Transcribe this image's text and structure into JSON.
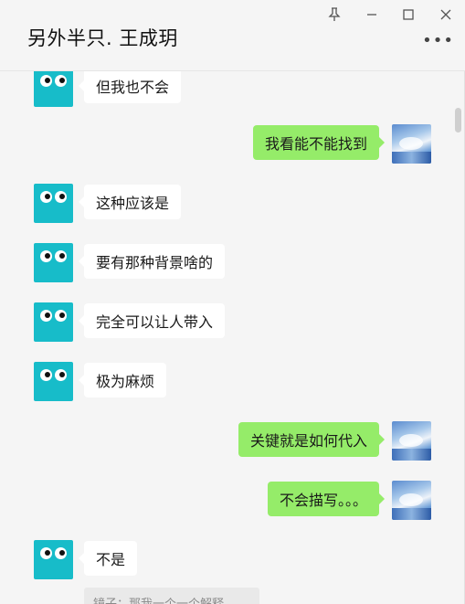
{
  "window": {
    "title": "另外半只. 王成玥",
    "more_label": "•••"
  },
  "messages": [
    {
      "side": "left",
      "text": "但我也不会"
    },
    {
      "side": "right",
      "text": "我看能不能找到"
    },
    {
      "side": "left",
      "text": "这种应该是"
    },
    {
      "side": "left",
      "text": "要有那种背景啥的"
    },
    {
      "side": "left",
      "text": "完全可以让人带入"
    },
    {
      "side": "left",
      "text": "极为麻烦"
    },
    {
      "side": "right",
      "text": "关键就是如何代入"
    },
    {
      "side": "right",
      "text": "不会描写。。。"
    },
    {
      "side": "left",
      "text": "不是"
    }
  ],
  "quote": {
    "text": "镜子：那我一个一个解释"
  },
  "icons": {
    "pin": "pin-icon",
    "minimize": "minimize-icon",
    "maximize": "maximize-icon",
    "close": "close-icon",
    "more": "more-options-icon",
    "contact_avatar": "cartoon-eyes-avatar",
    "self_avatar": "sky-clouds-avatar"
  },
  "colors": {
    "self_bubble": "#95ec69",
    "other_bubble": "#ffffff",
    "contact_avatar": "#17bcc9",
    "background": "#f5f5f5"
  }
}
